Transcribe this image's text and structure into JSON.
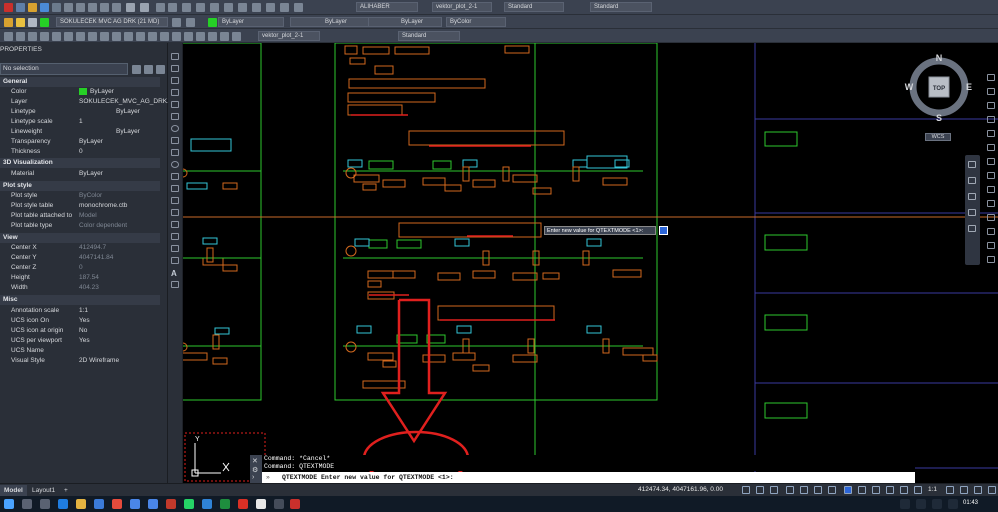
{
  "toolbar": {
    "layer_dropdown": "SOKULECEK MVC AG DRK (21 MD)",
    "color_dropdown": "ByLayer",
    "linetype_dropdown": "ByLayer",
    "lineweight_dropdown": "ByLayer",
    "plotstyle_dropdown": "ByColor",
    "color_dropdown2": "ByLayer",
    "textstyle_dropdown": "ALIHABER",
    "dimstyle_dropdown": "vektor_plot_2-1",
    "tablestyle_dropdown": "Standard",
    "mleaderstyle_dropdown": "Standard",
    "dimstyle_dropdown2": "vektor_plot_2-1",
    "textstyle_dropdown2": "Standard"
  },
  "properties": {
    "title": "PROPERTIES",
    "selection": "No selection",
    "sections": {
      "general": "General",
      "visualization": "3D Visualization",
      "plot_style": "Plot style",
      "view": "View",
      "misc": "Misc"
    },
    "general_rows": [
      {
        "key": "Color",
        "value": "ByLayer"
      },
      {
        "key": "Layer",
        "value": "SOKULECEK_MVC_AG_DRK..."
      },
      {
        "key": "Linetype",
        "value": "ByLayer"
      },
      {
        "key": "Linetype scale",
        "value": "1"
      },
      {
        "key": "Lineweight",
        "value": "ByLayer"
      },
      {
        "key": "Transparency",
        "value": "ByLayer"
      },
      {
        "key": "Thickness",
        "value": "0"
      }
    ],
    "visualization_rows": [
      {
        "key": "Material",
        "value": "ByLayer"
      }
    ],
    "plot_rows": [
      {
        "key": "Plot style",
        "value": "ByColor"
      },
      {
        "key": "Plot style table",
        "value": "monochrome.ctb"
      },
      {
        "key": "Plot table attached to",
        "value": "Model"
      },
      {
        "key": "Plot table type",
        "value": "Color dependent"
      }
    ],
    "view_rows": [
      {
        "key": "Center X",
        "value": "412494.7"
      },
      {
        "key": "Center Y",
        "value": "4047141.84"
      },
      {
        "key": "Center Z",
        "value": "0"
      },
      {
        "key": "Height",
        "value": "187.54"
      },
      {
        "key": "Width",
        "value": "404.23"
      }
    ],
    "misc_rows": [
      {
        "key": "Annotation scale",
        "value": "1:1"
      },
      {
        "key": "UCS icon On",
        "value": "Yes"
      },
      {
        "key": "UCS icon at origin",
        "value": "No"
      },
      {
        "key": "UCS per viewport",
        "value": "Yes"
      },
      {
        "key": "UCS Name",
        "value": ""
      },
      {
        "key": "Visual Style",
        "value": "2D Wireframe"
      }
    ]
  },
  "viewcube": {
    "north": "N",
    "south": "S",
    "east": "E",
    "west": "W",
    "face": "TOP",
    "wcs": "WCS"
  },
  "tooltip": {
    "text": "Enter new value for QTEXTMODE <1>:"
  },
  "ucs": {
    "x": "X",
    "y": "Y"
  },
  "command": {
    "line1": "Command: *Cancel*",
    "line2": "Command: QTEXTMODE",
    "prompt": "QTEXTMODE Enter new value for QTEXTMODE <1>:"
  },
  "status": {
    "tab_model": "Model",
    "tab_layout": "Layout1",
    "add_tab": "+",
    "coordinates": "412474.34, 4047161.96, 0.00",
    "scale": "1:1"
  },
  "taskbar": {
    "time": "01:43"
  },
  "colors": {
    "annotation_red": "#e0201e",
    "cad_orange": "#d2691e",
    "cad_green": "#2ec92e",
    "cad_cyan": "#35c6d8",
    "cad_blue": "#3a3aa0"
  }
}
